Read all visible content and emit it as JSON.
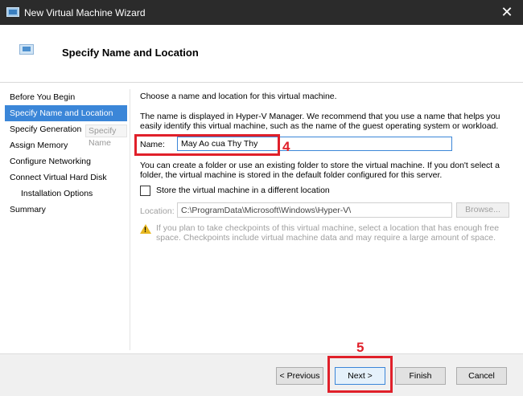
{
  "window": {
    "title": "New Virtual Machine Wizard",
    "close_glyph": "✕"
  },
  "header": {
    "title": "Specify Name and Location",
    "icon": "vm-monitor-icon"
  },
  "nav": {
    "items": [
      {
        "label": "Before You Begin",
        "active": false,
        "sub": false
      },
      {
        "label": "Specify Name and Location",
        "active": true,
        "sub": false
      },
      {
        "label": "Specify Generation",
        "active": false,
        "sub": false
      },
      {
        "label": "Assign Memory",
        "active": false,
        "sub": false
      },
      {
        "label": "Configure Networking",
        "active": false,
        "sub": false
      },
      {
        "label": "Connect Virtual Hard Disk",
        "active": false,
        "sub": false
      },
      {
        "label": "Installation Options",
        "active": false,
        "sub": true
      },
      {
        "label": "Summary",
        "active": false,
        "sub": false
      }
    ],
    "tooltip": "Specify Name"
  },
  "content": {
    "intro": "Choose a name and location for this virtual machine.",
    "name_help": "The name is displayed in Hyper-V Manager. We recommend that you use a name that helps you easily identify this virtual machine, such as the name of the guest operating system or workload.",
    "name_label": "Name:",
    "name_value": "May Ao cua Thy Thy",
    "folder_help": "You can create a folder or use an existing folder to store the virtual machine. If you don't select a folder, the virtual machine is stored in the default folder configured for this server.",
    "store_checkbox_label": "Store the virtual machine in a different location",
    "store_checked": false,
    "location_label": "Location:",
    "location_value": "C:\\ProgramData\\Microsoft\\Windows\\Hyper-V\\",
    "browse_label": "Browse...",
    "warning": "If you plan to take checkpoints of this virtual machine, select a location that has enough free space. Checkpoints include virtual machine data and may require a large amount of space."
  },
  "footer": {
    "previous": "< Previous",
    "next": "Next >",
    "finish": "Finish",
    "cancel": "Cancel"
  },
  "annotations": {
    "step_name": "4",
    "step_next": "5",
    "color": "#e0202a"
  },
  "colors": {
    "accent": "#3b86d8",
    "titlebar": "#2b2b2b",
    "warning": "#e8b820"
  }
}
